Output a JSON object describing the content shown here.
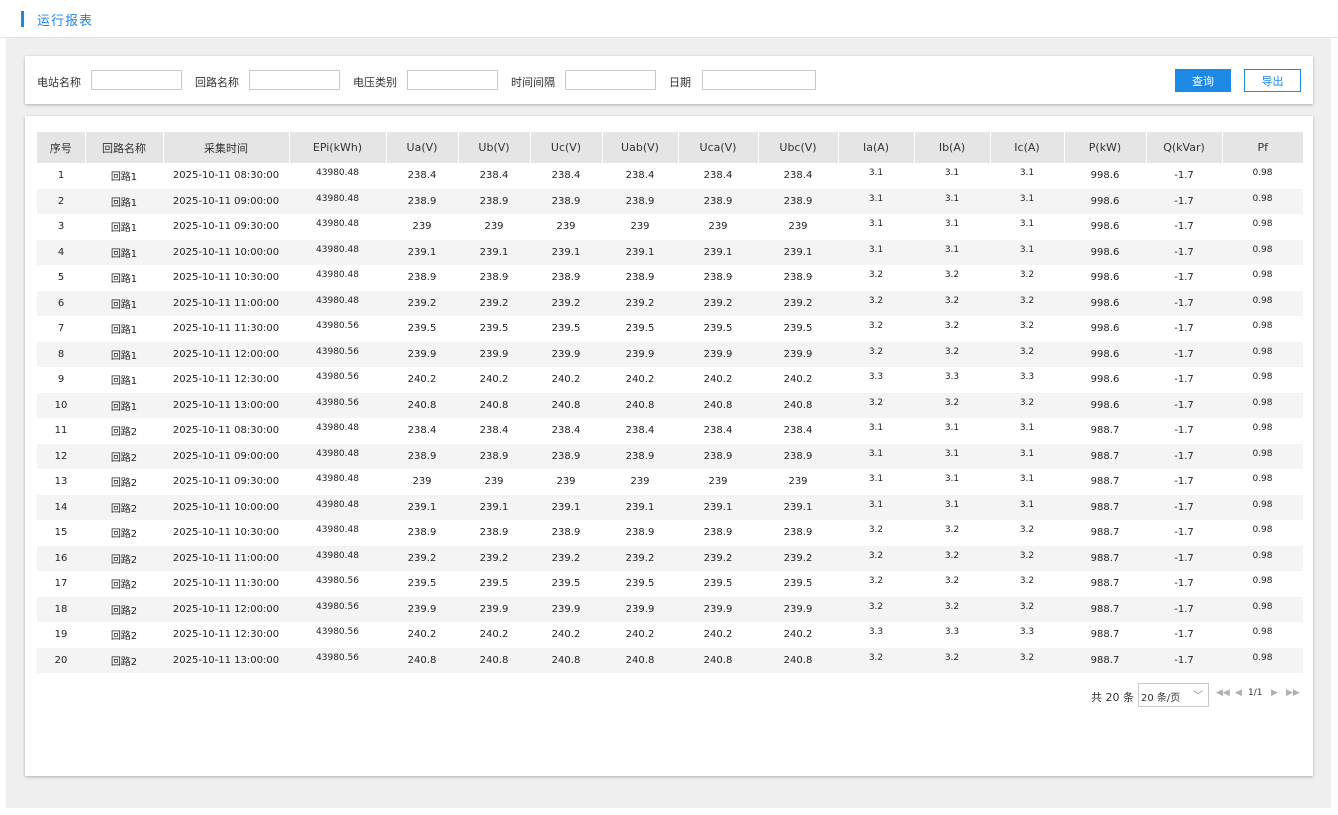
{
  "header": {
    "title": "运行报表"
  },
  "filters": {
    "station_label": "电站名称",
    "station_value": "",
    "loop_label": "回路名称",
    "loop_value": "",
    "voltage_label": "电压类别",
    "voltage_value": "",
    "interval_label": "时间间隔",
    "interval_value": "",
    "date_label": "日期",
    "date_value": "",
    "query_button": "查询",
    "export_button": "导出"
  },
  "table": {
    "columns": [
      "序号",
      "回路名称",
      "采集时间",
      "EPi(kWh)",
      "Ua(V)",
      "Ub(V)",
      "Uc(V)",
      "Uab(V)",
      "Uca(V)",
      "Ubc(V)",
      "Ia(A)",
      "Ib(A)",
      "Ic(A)",
      "P(kW)",
      "Q(kVar)",
      "Pf"
    ],
    "rows": [
      [
        "1",
        "回路1",
        "2025-10-11 08:30:00",
        "43980.48",
        "238.4",
        "238.4",
        "238.4",
        "238.4",
        "238.4",
        "238.4",
        "3.1",
        "3.1",
        "3.1",
        "998.6",
        "-1.7",
        "0.98"
      ],
      [
        "2",
        "回路1",
        "2025-10-11 09:00:00",
        "43980.48",
        "238.9",
        "238.9",
        "238.9",
        "238.9",
        "238.9",
        "238.9",
        "3.1",
        "3.1",
        "3.1",
        "998.6",
        "-1.7",
        "0.98"
      ],
      [
        "3",
        "回路1",
        "2025-10-11 09:30:00",
        "43980.48",
        "239",
        "239",
        "239",
        "239",
        "239",
        "239",
        "3.1",
        "3.1",
        "3.1",
        "998.6",
        "-1.7",
        "0.98"
      ],
      [
        "4",
        "回路1",
        "2025-10-11 10:00:00",
        "43980.48",
        "239.1",
        "239.1",
        "239.1",
        "239.1",
        "239.1",
        "239.1",
        "3.1",
        "3.1",
        "3.1",
        "998.6",
        "-1.7",
        "0.98"
      ],
      [
        "5",
        "回路1",
        "2025-10-11 10:30:00",
        "43980.48",
        "238.9",
        "238.9",
        "238.9",
        "238.9",
        "238.9",
        "238.9",
        "3.2",
        "3.2",
        "3.2",
        "998.6",
        "-1.7",
        "0.98"
      ],
      [
        "6",
        "回路1",
        "2025-10-11 11:00:00",
        "43980.48",
        "239.2",
        "239.2",
        "239.2",
        "239.2",
        "239.2",
        "239.2",
        "3.2",
        "3.2",
        "3.2",
        "998.6",
        "-1.7",
        "0.98"
      ],
      [
        "7",
        "回路1",
        "2025-10-11 11:30:00",
        "43980.56",
        "239.5",
        "239.5",
        "239.5",
        "239.5",
        "239.5",
        "239.5",
        "3.2",
        "3.2",
        "3.2",
        "998.6",
        "-1.7",
        "0.98"
      ],
      [
        "8",
        "回路1",
        "2025-10-11 12:00:00",
        "43980.56",
        "239.9",
        "239.9",
        "239.9",
        "239.9",
        "239.9",
        "239.9",
        "3.2",
        "3.2",
        "3.2",
        "998.6",
        "-1.7",
        "0.98"
      ],
      [
        "9",
        "回路1",
        "2025-10-11 12:30:00",
        "43980.56",
        "240.2",
        "240.2",
        "240.2",
        "240.2",
        "240.2",
        "240.2",
        "3.3",
        "3.3",
        "3.3",
        "998.6",
        "-1.7",
        "0.98"
      ],
      [
        "10",
        "回路1",
        "2025-10-11 13:00:00",
        "43980.56",
        "240.8",
        "240.8",
        "240.8",
        "240.8",
        "240.8",
        "240.8",
        "3.2",
        "3.2",
        "3.2",
        "998.6",
        "-1.7",
        "0.98"
      ],
      [
        "11",
        "回路2",
        "2025-10-11 08:30:00",
        "43980.48",
        "238.4",
        "238.4",
        "238.4",
        "238.4",
        "238.4",
        "238.4",
        "3.1",
        "3.1",
        "3.1",
        "988.7",
        "-1.7",
        "0.98"
      ],
      [
        "12",
        "回路2",
        "2025-10-11 09:00:00",
        "43980.48",
        "238.9",
        "238.9",
        "238.9",
        "238.9",
        "238.9",
        "238.9",
        "3.1",
        "3.1",
        "3.1",
        "988.7",
        "-1.7",
        "0.98"
      ],
      [
        "13",
        "回路2",
        "2025-10-11 09:30:00",
        "43980.48",
        "239",
        "239",
        "239",
        "239",
        "239",
        "239",
        "3.1",
        "3.1",
        "3.1",
        "988.7",
        "-1.7",
        "0.98"
      ],
      [
        "14",
        "回路2",
        "2025-10-11 10:00:00",
        "43980.48",
        "239.1",
        "239.1",
        "239.1",
        "239.1",
        "239.1",
        "239.1",
        "3.1",
        "3.1",
        "3.1",
        "988.7",
        "-1.7",
        "0.98"
      ],
      [
        "15",
        "回路2",
        "2025-10-11 10:30:00",
        "43980.48",
        "238.9",
        "238.9",
        "238.9",
        "238.9",
        "238.9",
        "238.9",
        "3.2",
        "3.2",
        "3.2",
        "988.7",
        "-1.7",
        "0.98"
      ],
      [
        "16",
        "回路2",
        "2025-10-11 11:00:00",
        "43980.48",
        "239.2",
        "239.2",
        "239.2",
        "239.2",
        "239.2",
        "239.2",
        "3.2",
        "3.2",
        "3.2",
        "988.7",
        "-1.7",
        "0.98"
      ],
      [
        "17",
        "回路2",
        "2025-10-11 11:30:00",
        "43980.56",
        "239.5",
        "239.5",
        "239.5",
        "239.5",
        "239.5",
        "239.5",
        "3.2",
        "3.2",
        "3.2",
        "988.7",
        "-1.7",
        "0.98"
      ],
      [
        "18",
        "回路2",
        "2025-10-11 12:00:00",
        "43980.56",
        "239.9",
        "239.9",
        "239.9",
        "239.9",
        "239.9",
        "239.9",
        "3.2",
        "3.2",
        "3.2",
        "988.7",
        "-1.7",
        "0.98"
      ],
      [
        "19",
        "回路2",
        "2025-10-11 12:30:00",
        "43980.56",
        "240.2",
        "240.2",
        "240.2",
        "240.2",
        "240.2",
        "240.2",
        "3.3",
        "3.3",
        "3.3",
        "988.7",
        "-1.7",
        "0.98"
      ],
      [
        "20",
        "回路2",
        "2025-10-11 13:00:00",
        "43980.56",
        "240.8",
        "240.8",
        "240.8",
        "240.8",
        "240.8",
        "240.8",
        "3.2",
        "3.2",
        "3.2",
        "988.7",
        "-1.7",
        "0.98"
      ]
    ]
  },
  "pagination": {
    "total_text": "共 20 条",
    "page_size": "20 条/页",
    "page_info": "1/1",
    "icons": [
      "first-page-icon",
      "prev-page-icon",
      "next-page-icon",
      "last-page-icon",
      "chevron-down-icon"
    ]
  },
  "colors": {
    "accent": "#1e88e5",
    "header_bg": "#e5e5e5",
    "stripe": "#f4f4f4",
    "page_bg": "#efefef"
  }
}
